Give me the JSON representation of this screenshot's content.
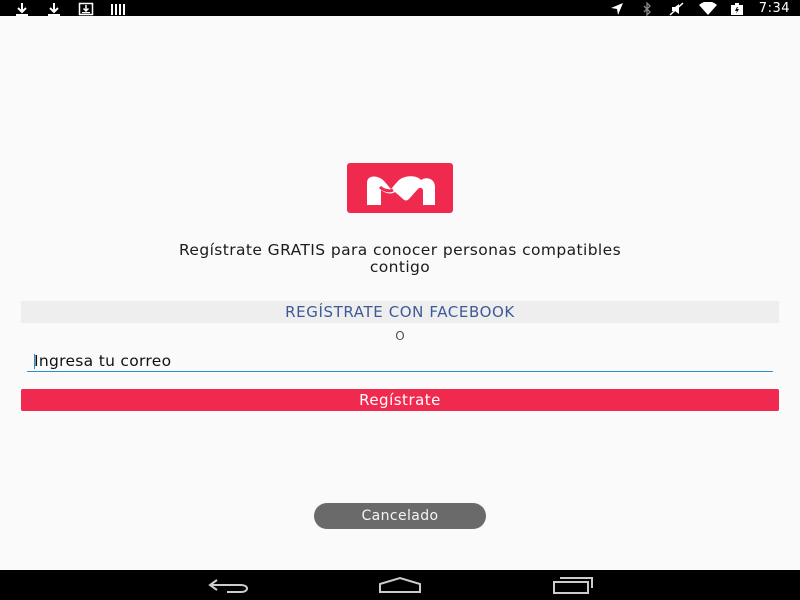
{
  "status_bar": {
    "left_icons": [
      "download-icon",
      "download-icon",
      "download-box-icon",
      "barcode-icon"
    ],
    "right_icons": [
      "location-icon",
      "bluetooth-icon",
      "mute-icon",
      "wifi-icon",
      "battery-charging-icon"
    ],
    "time": "7:34"
  },
  "logo": {
    "icon": "app-logo-icon",
    "color": "#f0294f"
  },
  "tagline": {
    "line1": "Regístrate GRATIS para conocer personas compatibles",
    "line2": "contigo"
  },
  "facebook_button": {
    "label": "REGÍSTRATE CON FACEBOOK",
    "color": "#3d5a98"
  },
  "separator": {
    "text": "O"
  },
  "email": {
    "placeholder": "Ingresa tu correo",
    "value": ""
  },
  "register_button": {
    "label": "Regístrate",
    "color": "#f0294f"
  },
  "toast": {
    "text": "Cancelado"
  },
  "nav_bar": {
    "buttons": [
      "back-icon",
      "home-icon",
      "recent-apps-icon"
    ]
  }
}
